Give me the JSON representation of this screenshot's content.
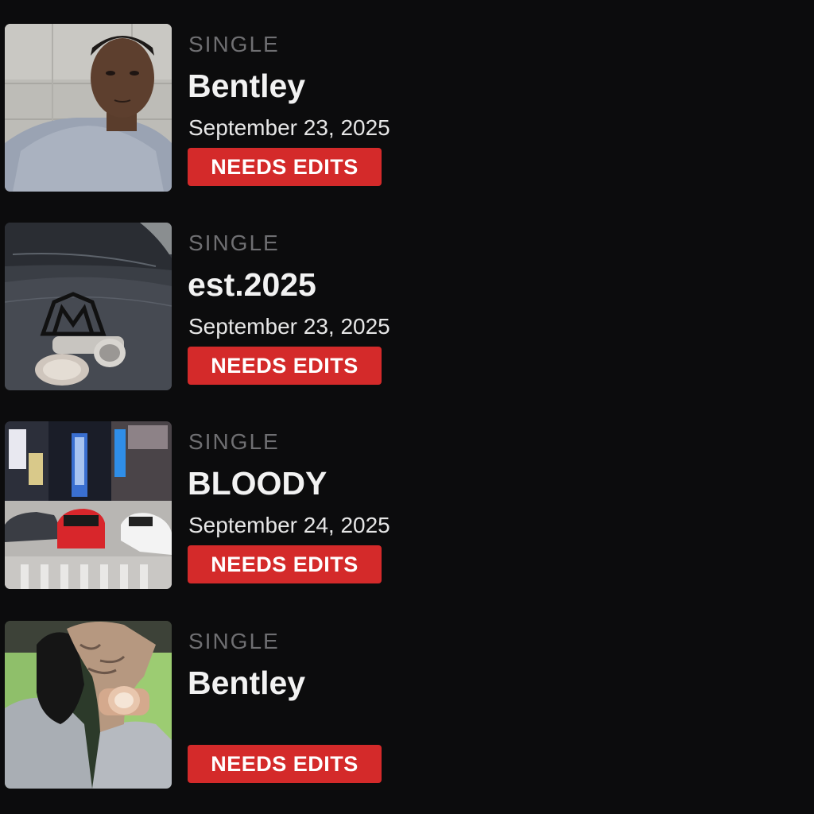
{
  "releases": [
    {
      "type": "SINGLE",
      "title": "Bentley",
      "date": "September 23, 2025",
      "status": "NEEDS EDITS"
    },
    {
      "type": "SINGLE",
      "title": "est.2025",
      "date": "September 23, 2025",
      "status": "NEEDS EDITS"
    },
    {
      "type": "SINGLE",
      "title": "BLOODY",
      "date": "September 24, 2025",
      "status": "NEEDS EDITS"
    },
    {
      "type": "SINGLE",
      "title": "Bentley",
      "date": "",
      "status": "NEEDS EDITS"
    }
  ],
  "colors": {
    "background": "#0c0c0d",
    "status_badge": "#d42a2a",
    "type_label": "#6f6f72",
    "title": "#f2f2f2"
  }
}
